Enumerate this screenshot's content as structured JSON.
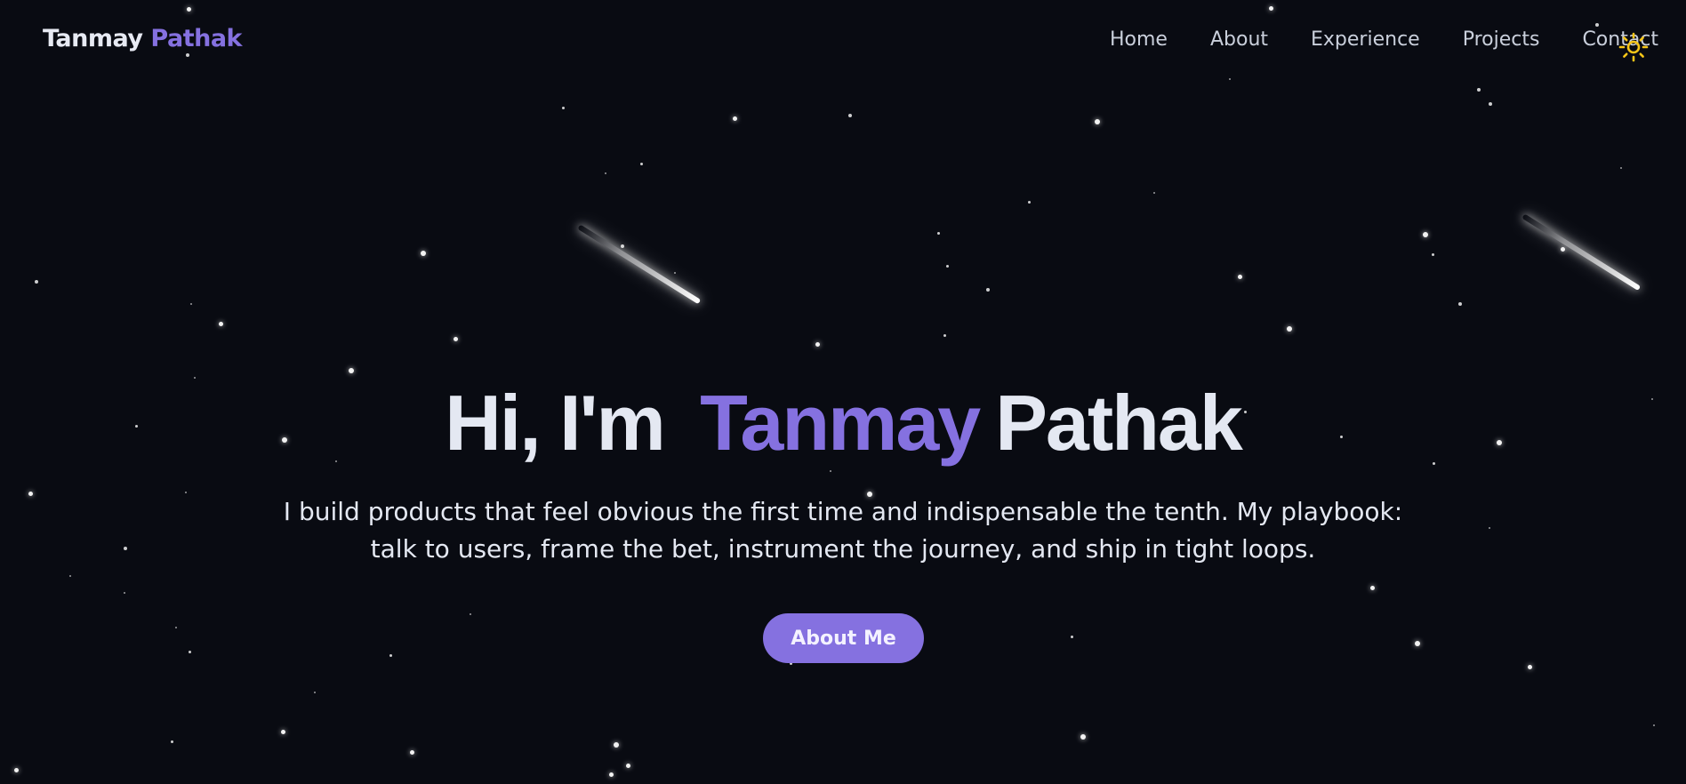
{
  "header": {
    "brand_first": "Tanmay",
    "brand_last": "Pathak",
    "nav": [
      {
        "label": "Home"
      },
      {
        "label": "About"
      },
      {
        "label": "Experience"
      },
      {
        "label": "Projects"
      },
      {
        "label": "Contact"
      }
    ],
    "theme_toggle_icon": "sun-icon"
  },
  "hero": {
    "greeting": "Hi, I'm",
    "first_name": "Tanmay",
    "last_name": "Pathak",
    "tagline": "I build products that feel obvious the first time and indispensable the tenth. My playbook: talk to users, frame the bet, instrument the journey, and ship in tight loops.",
    "cta_label": "About Me"
  },
  "colors": {
    "background": "#090b12",
    "accent": "#8571e0",
    "text": "#e4e8f2",
    "nav_text": "#c9cfdb",
    "sun": "#f5c518"
  }
}
